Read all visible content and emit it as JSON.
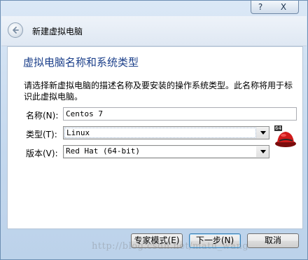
{
  "titlebar": {
    "help_label": "?",
    "close_label": "X"
  },
  "nav": {
    "title": "新建虚拟电脑"
  },
  "page": {
    "heading": "虚拟电脑名称和系统类型",
    "description": "请选择新虚拟电脑的描述名称及要安装的操作系统类型。此名称将用于标识此虚拟电脑。"
  },
  "form": {
    "name_label": "名称(N):",
    "name_value": "Centos 7",
    "type_label": "类型(T):",
    "type_value": "Linux",
    "version_label": "版本(V):",
    "version_value": "Red Hat (64-bit)"
  },
  "os_icon": {
    "badge": "64",
    "name": "redhat-icon"
  },
  "buttons": {
    "expert": "专家模式(E)",
    "next": "下一步(N)",
    "cancel": "取消"
  },
  "watermark": "http://blog.csdn.net/matu_wang"
}
